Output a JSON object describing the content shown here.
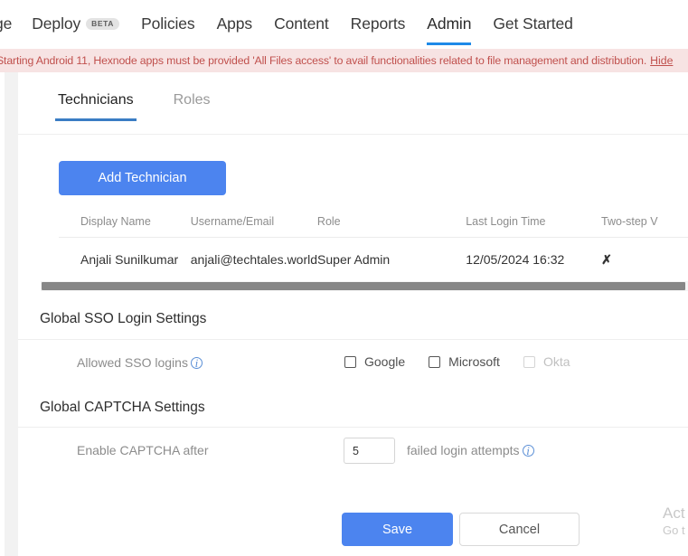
{
  "topnav": {
    "items": [
      {
        "label": "ge",
        "badge": null,
        "active": false,
        "cut": true
      },
      {
        "label": "Deploy",
        "badge": "BETA",
        "active": false,
        "cut": false
      },
      {
        "label": "Policies",
        "badge": null,
        "active": false,
        "cut": false
      },
      {
        "label": "Apps",
        "badge": null,
        "active": false,
        "cut": false
      },
      {
        "label": "Content",
        "badge": null,
        "active": false,
        "cut": false
      },
      {
        "label": "Reports",
        "badge": null,
        "active": false,
        "cut": false
      },
      {
        "label": "Admin",
        "badge": null,
        "active": true,
        "cut": false
      },
      {
        "label": "Get Started",
        "badge": null,
        "active": false,
        "cut": false
      }
    ]
  },
  "banner": {
    "text": "Starting Android 11, Hexnode apps must be provided  'All Files access'  to avail functionalities related to file management and distribution.",
    "hide_label": "Hide",
    "background": "#f7e3e3",
    "text_color": "#c0504d"
  },
  "tabs": [
    {
      "label": "Technicians",
      "active": true
    },
    {
      "label": "Roles",
      "active": false
    }
  ],
  "toolbar": {
    "add_technician_label": "Add Technician"
  },
  "table": {
    "columns": [
      "Display Name",
      "Username/Email",
      "Role",
      "Last Login Time",
      "Two-step V"
    ],
    "rows": [
      {
        "display_name": "Anjali Sunilkumar",
        "username_email": "anjali@techtales.world",
        "role": "Super Admin",
        "last_login_time": "12/05/2024 16:32",
        "two_step": "✗"
      }
    ]
  },
  "sso": {
    "section_title": "Global SSO Login Settings",
    "field_label": "Allowed SSO logins",
    "options": [
      {
        "label": "Google",
        "checked": false,
        "disabled": false
      },
      {
        "label": "Microsoft",
        "checked": false,
        "disabled": false
      },
      {
        "label": "Okta",
        "checked": false,
        "disabled": true
      }
    ]
  },
  "captcha": {
    "section_title": "Global CAPTCHA Settings",
    "field_label": "Enable CAPTCHA after",
    "value": "5",
    "placeholder": "5",
    "suffix_label": "failed login attempts"
  },
  "footer": {
    "save_label": "Save",
    "cancel_label": "Cancel"
  },
  "watermark": {
    "line1": "Act",
    "line2": "Go t"
  },
  "colors": {
    "primary_blue": "#4c84ef",
    "tab_underline": "#3b7dc4",
    "nav_underline": "#1e8ae8",
    "danger_red": "#e8453c",
    "banner_bg": "#f7e3e3"
  }
}
